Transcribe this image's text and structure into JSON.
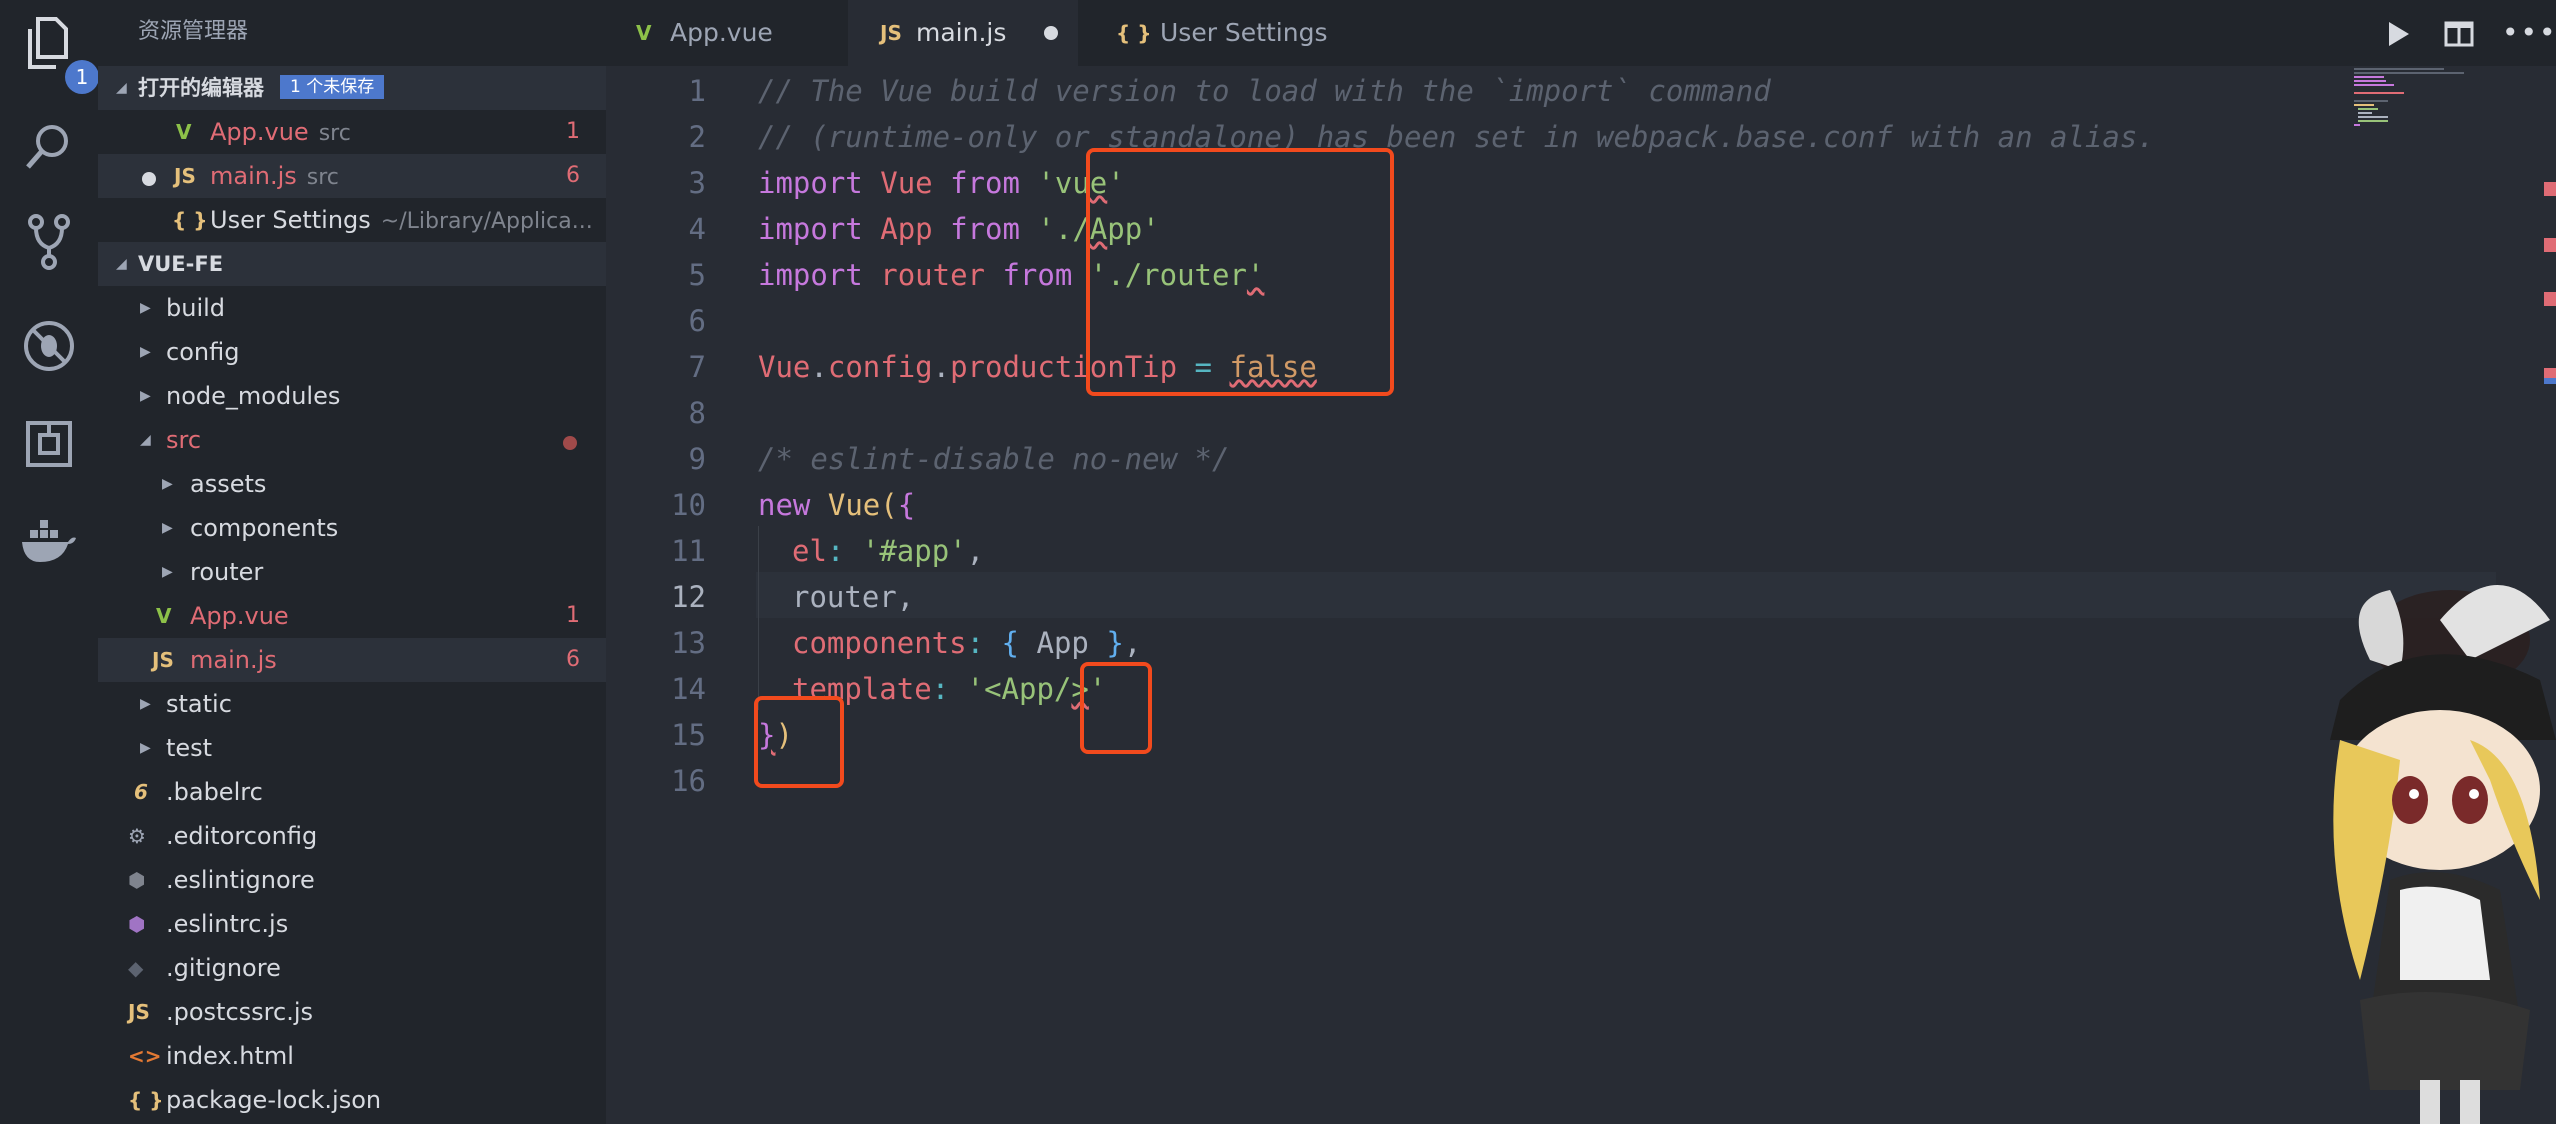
{
  "sidebar": {
    "title": "资源管理器",
    "open_editors": {
      "title": "打开的编辑器",
      "unsaved_badge": "1 个未保存",
      "items": [
        {
          "name": "App.vue",
          "path": "src",
          "count": "1"
        },
        {
          "name": "main.js",
          "path": "src",
          "count": "6"
        },
        {
          "name": "User Settings",
          "path": "~/Library/Applica..."
        }
      ]
    },
    "project": {
      "title": "VUE-FE",
      "tree": [
        {
          "label": "build"
        },
        {
          "label": "config"
        },
        {
          "label": "node_modules"
        },
        {
          "label": "src"
        },
        {
          "label": "assets"
        },
        {
          "label": "components"
        },
        {
          "label": "router"
        },
        {
          "label": "App.vue",
          "count": "1"
        },
        {
          "label": "main.js",
          "count": "6"
        },
        {
          "label": "static"
        },
        {
          "label": "test"
        },
        {
          "label": ".babelrc"
        },
        {
          "label": ".editorconfig"
        },
        {
          "label": ".eslintignore"
        },
        {
          "label": ".eslintrc.js"
        },
        {
          "label": ".gitignore"
        },
        {
          "label": ".postcssrc.js"
        },
        {
          "label": "index.html"
        },
        {
          "label": "package-lock.json"
        }
      ]
    }
  },
  "activity": {
    "explorer_badge": "1"
  },
  "tabs": [
    {
      "label": "App.vue"
    },
    {
      "label": "main.js"
    },
    {
      "label": "User Settings"
    }
  ],
  "icons": {
    "vue": "V",
    "js": "JS",
    "json": "{ }",
    "babel": "6",
    "html": "<>"
  },
  "editor": {
    "line_numbers": [
      "1",
      "2",
      "3",
      "4",
      "5",
      "6",
      "7",
      "8",
      "9",
      "10",
      "11",
      "12",
      "13",
      "14",
      "15",
      "16"
    ],
    "current_line": "12",
    "code": {
      "l1": "// The Vue build version to load with the `import` command",
      "l2": "// (runtime-only or standalone) has been set in webpack.base.conf with an alias.",
      "l3": {
        "k1": "import",
        "v": "Vue",
        "k2": "from",
        "s1": "'vu",
        "s2": "e",
        "s3": "'"
      },
      "l4": {
        "k1": "import",
        "v": "App",
        "k2": "from",
        "s1": "'./",
        "s2": "A",
        "s3": "pp'"
      },
      "l5": {
        "k1": "import",
        "v": "router",
        "k2": "from",
        "s1": "'./router",
        "s2": "'"
      },
      "l7": {
        "obj": "Vue",
        "d1": ".",
        "p1": "config",
        "d2": ".",
        "p2": "productionTip",
        "eq": "=",
        "val": "false"
      },
      "l9": "/* eslint-disable no-new */",
      "l10": {
        "kw": "new",
        "fn": "Vue",
        "p": "(",
        "b": "{"
      },
      "l11": {
        "key": "el",
        "colon": ":",
        "val": "'#app'",
        "comma": ","
      },
      "l12": "router,",
      "l13": {
        "key": "components",
        "colon": ":",
        "ob": "{",
        "val": "App",
        "cb": "}",
        "comma": ","
      },
      "l14": {
        "key": "template",
        "colon": ":",
        "s1": "'<App/",
        "s2": ">",
        "s3": "'"
      },
      "l15": {
        "b": "}",
        "p": ")"
      }
    }
  },
  "colors": {
    "accent": "#4d78cc",
    "annotation": "#f24a1d",
    "error": "#e06c75"
  }
}
